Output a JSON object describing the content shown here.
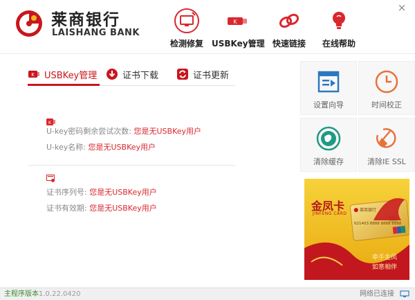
{
  "brand": {
    "name_cn": "莱商银行",
    "name_en": "LAISHANG BANK"
  },
  "window": {
    "close_glyph": "×"
  },
  "nav": [
    {
      "label": "检测修复",
      "icon": "monitor-repair-icon"
    },
    {
      "label": "USBKey管理",
      "icon": "usbkey-icon"
    },
    {
      "label": "快速链接",
      "icon": "link-icon"
    },
    {
      "label": "在线帮助",
      "icon": "lightbulb-icon"
    }
  ],
  "tabs": [
    {
      "label": "USBKey管理",
      "icon": "usbkey-icon",
      "active": true
    },
    {
      "label": "证书下载",
      "icon": "download-icon",
      "active": false
    },
    {
      "label": "证书更新",
      "icon": "refresh-icon",
      "active": false
    }
  ],
  "usbkey_info": {
    "pin_retry_label": "U-key密码剩余尝试次数:",
    "pin_retry_value": "您是无USBKey用户",
    "name_label": "U-key名称:",
    "name_value": "您是无USBKey用户"
  },
  "cert_info": {
    "serial_label": "证书序列号:",
    "serial_value": "您是无USBKey用户",
    "validity_label": "证书有效期:",
    "validity_value": "您是无USBKey用户"
  },
  "tools": [
    {
      "label": "设置向导",
      "icon": "wizard-icon"
    },
    {
      "label": "时间校正",
      "icon": "clock-icon"
    },
    {
      "label": "清除缓存",
      "icon": "clear-cache-icon"
    },
    {
      "label": "清除IE SSL",
      "icon": "broom-icon"
    }
  ],
  "banner": {
    "title": "金凤卡",
    "subtitle": "JINFENG CARD",
    "card_bank": "莱商银行",
    "card_number": "621403 8888 8888 8888",
    "slogan_line1": "牵手金凤",
    "slogan_line2": "如意相伴"
  },
  "status": {
    "version_label": "主程序版本",
    "version": "1.0.22.0420",
    "network": "网络已连接"
  },
  "colors": {
    "accent": "#c8161d",
    "value_red": "#d9272e",
    "status_green": "#3a8a30"
  }
}
